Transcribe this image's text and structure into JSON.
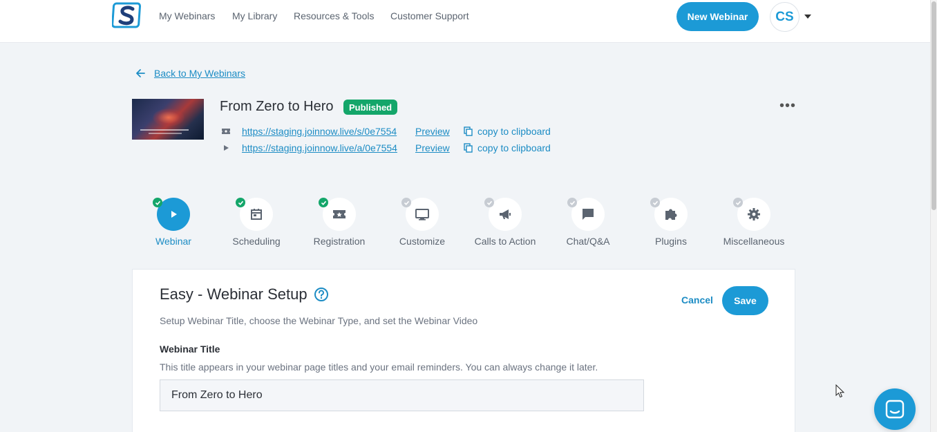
{
  "nav": {
    "links": [
      "My Webinars",
      "My Library",
      "Resources & Tools",
      "Customer Support"
    ],
    "new_webinar": "New Webinar",
    "avatar_initials": "CS"
  },
  "back_label": "Back to My Webinars",
  "webinar": {
    "title": "From Zero to Hero",
    "status": "Published",
    "registration_url": "https://staging.joinnow.live/s/0e7554",
    "attendee_url": "https://staging.joinnow.live/a/0e7554",
    "preview_label": "Preview",
    "copy_label": "copy to clipboard"
  },
  "steps": [
    {
      "label": "Webinar",
      "icon": "play-icon",
      "done": true,
      "active": true
    },
    {
      "label": "Scheduling",
      "icon": "calendar-icon",
      "done": true,
      "active": false
    },
    {
      "label": "Registration",
      "icon": "ticket-icon",
      "done": true,
      "active": false
    },
    {
      "label": "Customize",
      "icon": "monitor-icon",
      "done": false,
      "active": false
    },
    {
      "label": "Calls to Action",
      "icon": "megaphone-icon",
      "done": false,
      "active": false
    },
    {
      "label": "Chat/Q&A",
      "icon": "chat-bubble-icon",
      "done": false,
      "active": false
    },
    {
      "label": "Plugins",
      "icon": "puzzle-icon",
      "done": false,
      "active": false
    },
    {
      "label": "Miscellaneous",
      "icon": "gear-icon",
      "done": false,
      "active": false
    }
  ],
  "card": {
    "title": "Easy - Webinar Setup",
    "subtitle": "Setup Webinar Title, choose the Webinar Type, and set the Webinar Video",
    "cancel": "Cancel",
    "save": "Save",
    "field_label": "Webinar Title",
    "field_help": "This title appears in your webinar page titles and your email reminders. You can always change it later.",
    "field_value": "From Zero to Hero"
  },
  "colors": {
    "accent": "#1c9ad6",
    "link": "#1c8cc4",
    "success": "#14a66a",
    "background": "#f1f4f7"
  }
}
